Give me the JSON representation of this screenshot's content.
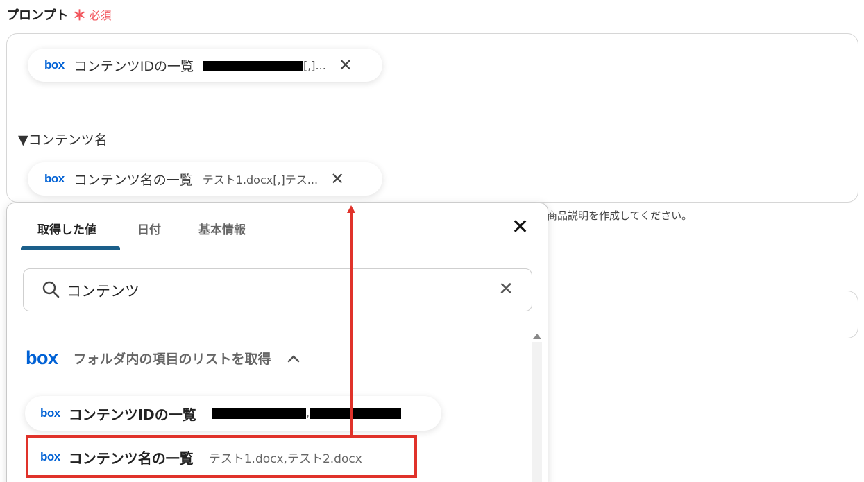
{
  "field": {
    "title": "プロンプト",
    "required_mark": "＊",
    "required_label": "必須"
  },
  "prompt": {
    "pill1": {
      "icon": "box",
      "label": "コンテンツIDの一覧",
      "value_suffix": "[,]..."
    },
    "section_label": "▼コンテンツ名",
    "pill2": {
      "icon": "box",
      "label": "コンテンツ名の一覧",
      "value": "テスト1.docx[,]テス..."
    }
  },
  "helper_text": "商品説明を作成してください。",
  "popup": {
    "tabs": [
      {
        "label": "取得した値"
      },
      {
        "label": "日付"
      },
      {
        "label": "基本情報"
      }
    ],
    "search": {
      "value": "コンテンツ"
    },
    "group": {
      "icon": "box",
      "title": "フォルダ内の項目のリストを取得"
    },
    "items": [
      {
        "icon": "box",
        "label": "コンテンツIDの一覧",
        "separator": ","
      },
      {
        "icon": "box",
        "label": "コンテンツ名の一覧",
        "value": "テスト1.docx,テスト2.docx"
      }
    ]
  },
  "colors": {
    "required": "#f2545b",
    "box_brand": "#0061d5",
    "tab_active": "#1b5f8a",
    "highlight": "#e0322a"
  }
}
